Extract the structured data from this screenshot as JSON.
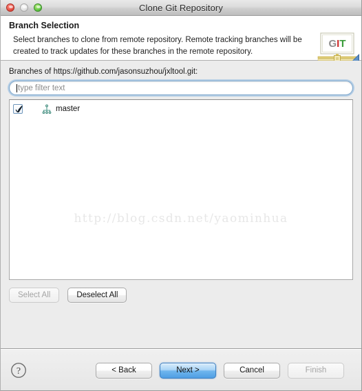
{
  "window": {
    "title": "Clone Git Repository",
    "traffic_lights": [
      {
        "name": "close",
        "color": "#e0483b"
      },
      {
        "name": "minimize",
        "color": "#dcdcdc"
      },
      {
        "name": "zoom",
        "color": "#56c13c"
      }
    ]
  },
  "header": {
    "title": "Branch Selection",
    "description": "Select branches to clone from remote repository. Remote tracking branches will be created to track updates for these branches in the remote repository.",
    "banner_icon": "git-banner-icon",
    "banner_letters": [
      {
        "char": "G",
        "color": "#8a8a8a"
      },
      {
        "char": "I",
        "color": "#cc2b2b"
      },
      {
        "char": "T",
        "color": "#3a9b3a"
      }
    ]
  },
  "main": {
    "branches_label": "Branches of https://github.com/jasonsuzhou/jxltool.git:",
    "filter": {
      "placeholder": "type filter text",
      "value": ""
    },
    "tree": {
      "items": [
        {
          "label": "master",
          "checked": true,
          "icon": "git-branch-icon"
        }
      ]
    },
    "watermark": "http://blog.csdn.net/yaominhua",
    "selection_buttons": [
      {
        "name": "select-all-button",
        "label": "Select All",
        "enabled": false
      },
      {
        "name": "deselect-all-button",
        "label": "Deselect All",
        "enabled": true
      }
    ]
  },
  "footer": {
    "help_icon": "help-question-icon",
    "buttons": [
      {
        "name": "back-button",
        "label": "< Back",
        "enabled": true,
        "default": false
      },
      {
        "name": "next-button",
        "label": "Next >",
        "enabled": true,
        "default": true
      },
      {
        "name": "cancel-button",
        "label": "Cancel",
        "enabled": true,
        "default": false
      },
      {
        "name": "finish-button",
        "label": "Finish",
        "enabled": false,
        "default": false
      }
    ]
  },
  "colors": {
    "default_button_accent": "#4f9ee4",
    "focus_ring": "#74aade",
    "window_background": "#ececec",
    "list_background": "#ffffff"
  }
}
